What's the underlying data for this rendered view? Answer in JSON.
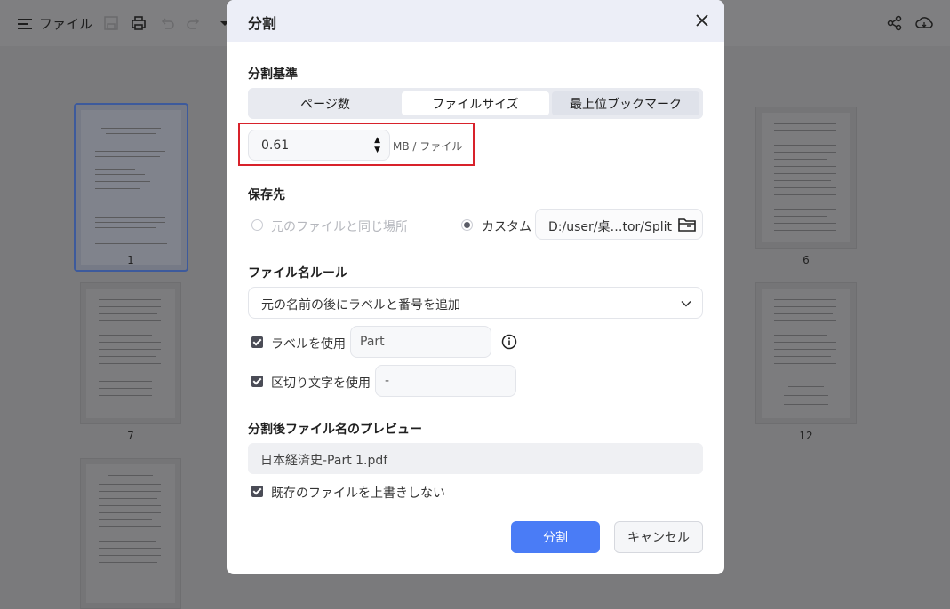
{
  "toolbar": {
    "menu_label": "ファイル",
    "icons": [
      "menu-icon",
      "save-icon",
      "print-icon",
      "undo-icon",
      "redo-icon",
      "dropdown-icon",
      "share-icon",
      "cloud-icon"
    ]
  },
  "thumbnails": {
    "page_numbers": [
      "1",
      "6",
      "7",
      "12"
    ]
  },
  "dialog": {
    "title": "分割",
    "split_criteria": {
      "heading": "分割基準",
      "tabs": [
        "ページ数",
        "ファイルサイズ",
        "最上位ブックマーク"
      ],
      "selected_tab": "ファイルサイズ",
      "size_value": "0.61",
      "size_unit": "MB / ファイル"
    },
    "destination": {
      "heading": "保存先",
      "option_same": "元のファイルと同じ場所",
      "option_custom": "カスタム",
      "custom_path": "D:/user/桌…tor/Split",
      "selected": "カスタム"
    },
    "filename_rule": {
      "heading": "ファイル名ルール",
      "selected_rule": "元の名前の後にラベルと番号を追加",
      "use_label": "ラベルを使用",
      "label_value": "Part",
      "use_separator": "区切り文字を使用",
      "separator_value": "-"
    },
    "preview": {
      "heading": "分割後ファイル名のプレビュー",
      "filename": "日本経済史-Part 1.pdf"
    },
    "no_overwrite": "既存のファイルを上書きしない",
    "buttons": {
      "split": "分割",
      "cancel": "キャンセル"
    }
  },
  "colors": {
    "primary": "#4a7cf6",
    "highlight": "#d8222b",
    "header_bg": "#eceef7"
  }
}
